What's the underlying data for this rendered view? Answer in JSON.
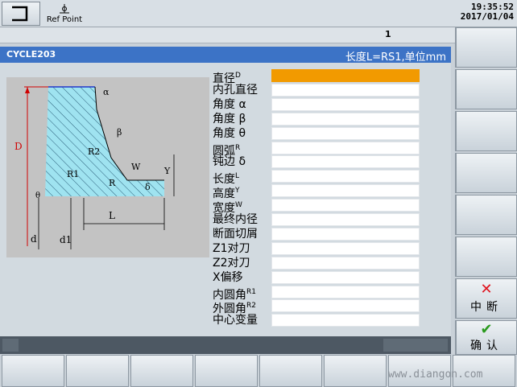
{
  "header": {
    "refpoint_label": "Ref Point",
    "time": "19:35:52",
    "date": "2017/01/04"
  },
  "channel": {
    "number": "1"
  },
  "title": {
    "cycle": "CYCLE203",
    "info": "长度L=RS1,单位mm"
  },
  "diagram": {
    "labels": [
      "α",
      "β",
      "R2",
      "W",
      "R",
      "Y",
      "δ",
      "R1",
      "D",
      "θ",
      "L",
      "d",
      "d1"
    ]
  },
  "fields": [
    {
      "label": "直径",
      "sup": "D"
    },
    {
      "label": "内孔直径",
      "sup": ""
    },
    {
      "label": "角度 α",
      "sup": ""
    },
    {
      "label": "角度 β",
      "sup": ""
    },
    {
      "label": "角度 θ",
      "sup": ""
    },
    {
      "label": "圆弧",
      "sup": "R"
    },
    {
      "label": "钝边 δ",
      "sup": ""
    },
    {
      "label": "长度",
      "sup": "L"
    },
    {
      "label": "高度",
      "sup": "Y"
    },
    {
      "label": "宽度",
      "sup": "W"
    },
    {
      "label": "最终内径",
      "sup": ""
    },
    {
      "label": "断面切屑",
      "sup": ""
    },
    {
      "label": "Z1对刀",
      "sup": ""
    },
    {
      "label": "Z2对刀",
      "sup": ""
    },
    {
      "label": "X偏移",
      "sup": ""
    },
    {
      "label": "内圆角",
      "sup": "R1"
    },
    {
      "label": "外圆角",
      "sup": "R2"
    },
    {
      "label": "中心变量",
      "sup": ""
    }
  ],
  "softkeys": {
    "abort_label": "中断",
    "confirm_label": "确认"
  },
  "watermark": "www.diangon.com",
  "colors": {
    "title_bar": "#3c73c6",
    "active_field": "#f29a00",
    "abort_icon": "#e0141e",
    "confirm_icon": "#2a9a1e"
  }
}
